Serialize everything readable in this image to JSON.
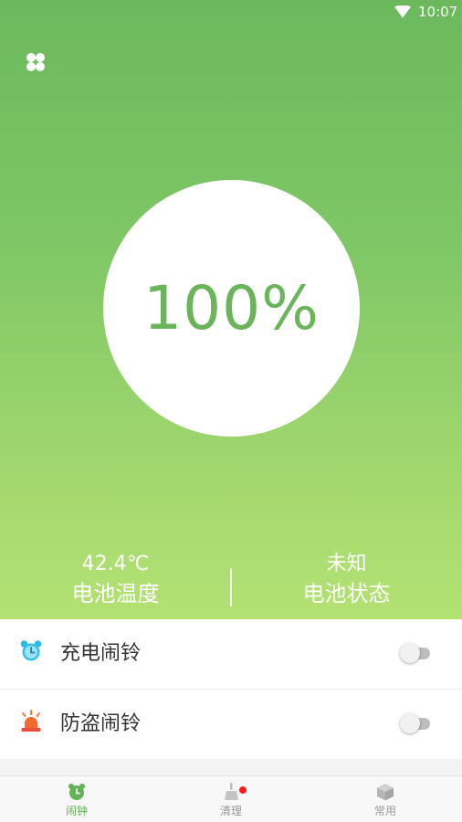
{
  "status_bar": {
    "time": "10:07",
    "wifi_icon": "wifi-icon"
  },
  "header": {
    "menu_icon": "clover-icon"
  },
  "battery": {
    "percent_text": "100%",
    "level": 1.0
  },
  "stats": {
    "temperature": {
      "value": "42.4℃",
      "label": "电池温度"
    },
    "status": {
      "value": "未知",
      "label": "电池状态"
    }
  },
  "settings": [
    {
      "label": "充电闹铃",
      "icon": "alarm-clock-icon",
      "enabled": false
    },
    {
      "label": "防盗闹铃",
      "icon": "siren-icon",
      "enabled": false
    }
  ],
  "bottom_nav": [
    {
      "label": "闹钟",
      "icon": "alarm-clock-icon",
      "active": true
    },
    {
      "label": "清理",
      "icon": "broom-icon",
      "active": false,
      "badge": true
    },
    {
      "label": "常用",
      "icon": "box-icon",
      "active": false
    }
  ],
  "colors": {
    "accent_green": "#6ab45a",
    "gradient_top": "#6cb95d",
    "gradient_bottom": "#b3e273",
    "badge_red": "#ff1c1c"
  }
}
